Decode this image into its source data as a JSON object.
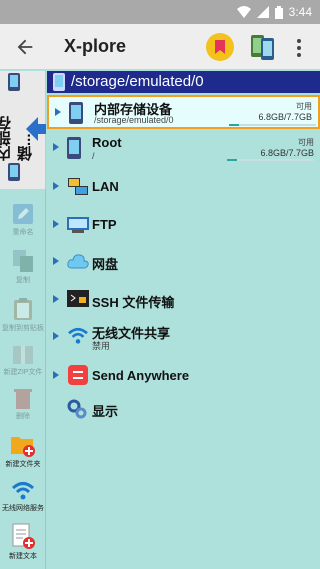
{
  "status_bar": {
    "time": "3:44"
  },
  "app_bar": {
    "title": "X-plore"
  },
  "sidebar": {
    "tab_label": "内部存储...",
    "buttons": [
      {
        "label": "重命名",
        "icon": "edit-icon",
        "enabled": false
      },
      {
        "label": "复制",
        "icon": "copy-icon",
        "enabled": false
      },
      {
        "label": "复制到剪贴板",
        "icon": "clipboard-icon",
        "enabled": false
      },
      {
        "label": "新建ZIP文件",
        "icon": "zip-icon",
        "enabled": false
      },
      {
        "label": "删除",
        "icon": "trash-icon",
        "enabled": false
      },
      {
        "label": "新建文件夹",
        "icon": "new-folder-icon",
        "enabled": true
      },
      {
        "label": "无线网络服务",
        "icon": "wifi-icon",
        "enabled": true
      },
      {
        "label": "新建文本",
        "icon": "new-text-icon",
        "enabled": true
      }
    ]
  },
  "path_bar": {
    "text": "/storage/emulated/0"
  },
  "list": {
    "internal": {
      "name": "内部存储设备",
      "path": "/storage/emulated/0",
      "free_label": "可用",
      "size": "6.8GB/7.7GB",
      "usage": 0.12
    },
    "root": {
      "name": "Root",
      "path": "/",
      "free_label": "可用",
      "size": "6.8GB/7.7GB",
      "usage": 0.12
    },
    "lan": {
      "name": "LAN"
    },
    "ftp": {
      "name": "FTP"
    },
    "cloud": {
      "name": "网盘"
    },
    "ssh": {
      "name": "SSH 文件传输"
    },
    "wifi_share": {
      "name": "无线文件共享",
      "status": "禁用"
    },
    "send_anywhere": {
      "name": "Send Anywhere"
    },
    "display": {
      "name": "显示"
    }
  }
}
